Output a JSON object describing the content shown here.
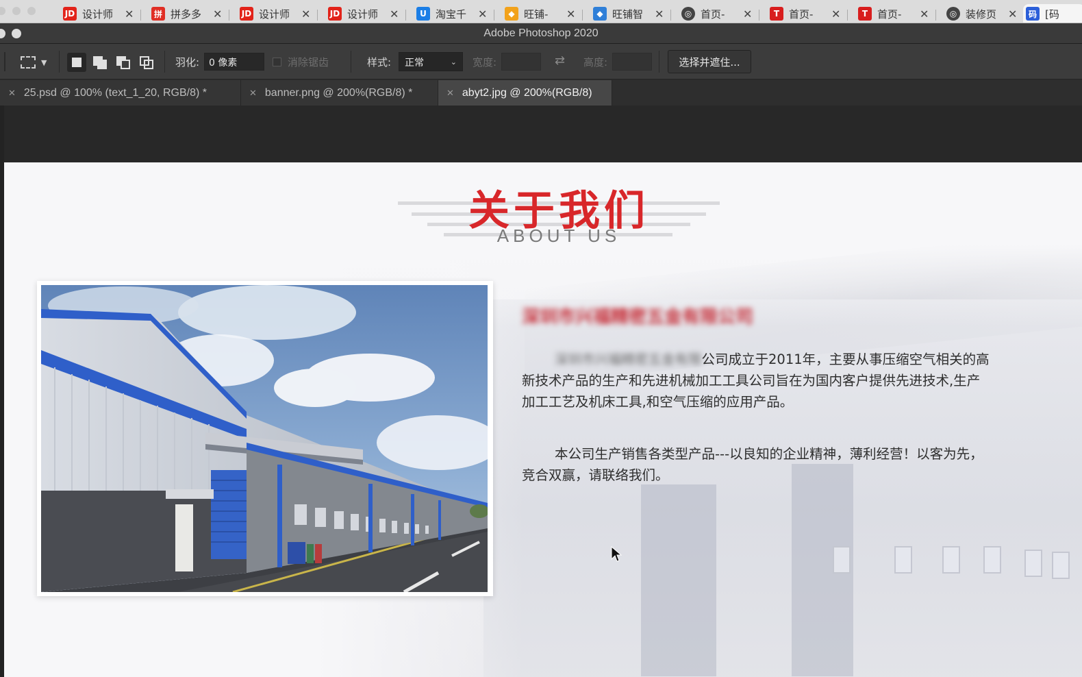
{
  "browser_tabs": [
    {
      "favicon": "JD",
      "color": "#e2231a",
      "label": "设计师"
    },
    {
      "favicon": "拼",
      "color": "#e02e24",
      "label": "拼多多"
    },
    {
      "favicon": "JD",
      "color": "#e2231a",
      "label": "设计师"
    },
    {
      "favicon": "JD",
      "color": "#e2231a",
      "label": "设计师"
    },
    {
      "favicon": "U",
      "color": "#1b7ee6",
      "label": "淘宝千"
    },
    {
      "favicon": "◆",
      "color": "#f2a21b",
      "label": "旺铺-"
    },
    {
      "favicon": "◆",
      "color": "#2f7fd8",
      "label": "旺铺智"
    },
    {
      "favicon": "◎",
      "color": "#444444",
      "label": "首页-"
    },
    {
      "favicon": "T",
      "color": "#d81e1e",
      "label": "首页-"
    },
    {
      "favicon": "T",
      "color": "#d81e1e",
      "label": "首页-"
    },
    {
      "favicon": "◎",
      "color": "#444444",
      "label": "装修页"
    },
    {
      "favicon": "码",
      "color": "#2b5fd9",
      "label": "[码"
    }
  ],
  "ps": {
    "title": "Adobe Photoshop 2020",
    "options": {
      "feather_label": "羽化:",
      "feather_value": "0 像素",
      "antialias_label": "消除锯齿",
      "style_label": "样式:",
      "style_value": "正常",
      "width_label": "宽度:",
      "height_label": "高度:",
      "select_mask_label": "选择并遮住..."
    },
    "doc_tabs": [
      {
        "label": "25.psd @ 100% (text_1_20, RGB/8) *"
      },
      {
        "label": "banner.png @ 200%(RGB/8) *"
      },
      {
        "label": "abyt2.jpg @ 200%(RGB/8)"
      }
    ]
  },
  "document": {
    "heading_cn": "关于我们",
    "heading_en": "ABOUT US",
    "company_name_blurred": "深圳市兴福精密五金有限公司",
    "para1_blurred": "深圳市兴福精密五金有限",
    "para1_line1": "公司成立于2011年，主要从事压缩空气相关的高",
    "para1_line2": "新技术产品的生产和先进机械加工工具公司旨在为国内客户提供先进技术,生产",
    "para1_line3": "加工工艺及机床工具,和空气压缩的应用产品。",
    "para2_line1": "本公司生产销售各类型产品---以良知的企业精神，薄利经营！以客为先，",
    "para2_line2": "竞合双赢，请联络我们。"
  },
  "colors": {
    "heading_red": "#d8272a",
    "ps_panel": "#3c3c3c",
    "ps_canvas_bg": "#282828"
  }
}
